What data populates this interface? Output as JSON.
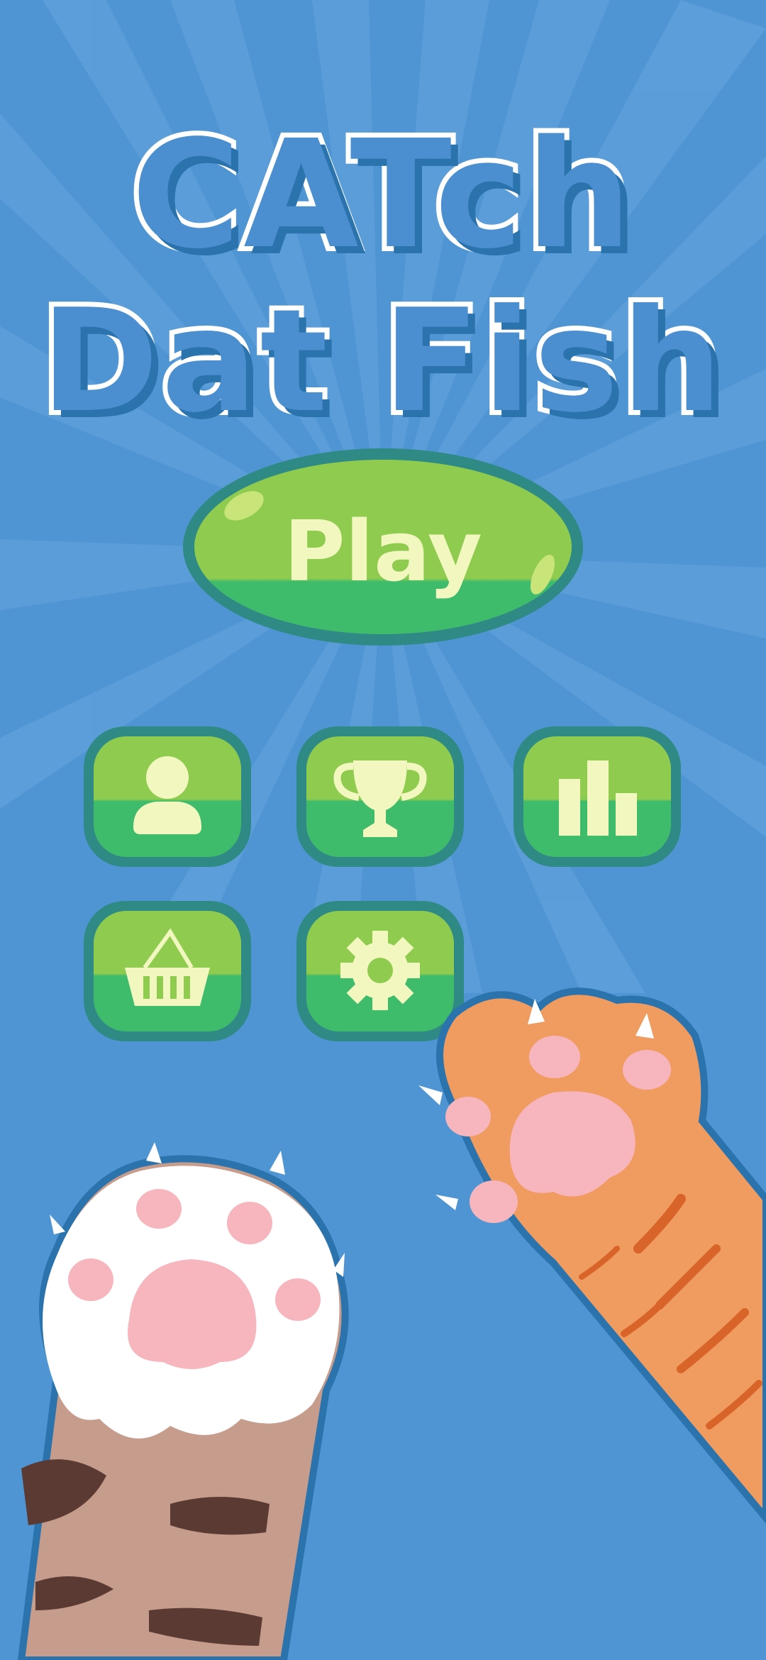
{
  "title": {
    "line1": "CATch",
    "line2": "Dat Fish"
  },
  "play_button": {
    "label": "Play"
  },
  "menu": [
    {
      "id": "profile",
      "icon": "person-icon"
    },
    {
      "id": "trophy",
      "icon": "trophy-icon"
    },
    {
      "id": "stats",
      "icon": "bar-chart-icon"
    },
    {
      "id": "shop",
      "icon": "basket-icon"
    },
    {
      "id": "settings",
      "icon": "gear-icon"
    }
  ],
  "colors": {
    "background": "#4f95d4",
    "button_green": "#8fcb4e",
    "button_lower": "#3fbb6c",
    "button_border": "#2f8a86",
    "icon": "#f2f7c0",
    "title_fill": "#4b8fd1",
    "title_outline": "#ffffff"
  }
}
